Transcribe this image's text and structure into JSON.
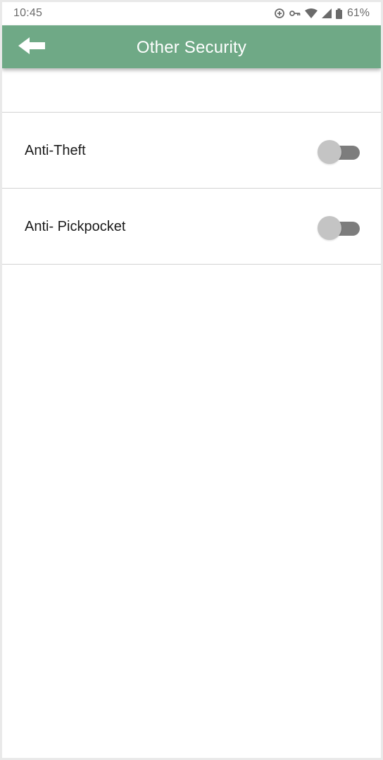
{
  "status_bar": {
    "time": "10:45",
    "battery_percent": "61%",
    "icons": [
      "data-saver-icon",
      "vpn-key-icon",
      "wifi-icon",
      "cellular-signal-icon",
      "battery-icon"
    ]
  },
  "app_bar": {
    "title": "Other Security",
    "back_icon": "back-arrow-icon",
    "background_color": "#6fa986"
  },
  "settings": [
    {
      "label": "Anti-Theft",
      "enabled": false
    },
    {
      "label": "Anti- Pickpocket",
      "enabled": false
    }
  ]
}
